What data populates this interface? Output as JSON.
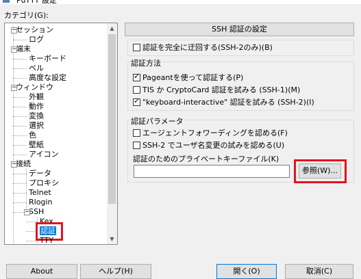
{
  "window": {
    "title": "PuTTY 設定"
  },
  "category_label": "カテゴリ(G):",
  "tree": [
    {
      "label": "セッション",
      "level": 0,
      "expander": "−"
    },
    {
      "label": "ログ",
      "level": 1
    },
    {
      "label": "端末",
      "level": 0,
      "expander": "−"
    },
    {
      "label": "キーボード",
      "level": 1
    },
    {
      "label": "ベル",
      "level": 1
    },
    {
      "label": "高度な設定",
      "level": 1
    },
    {
      "label": "ウィンドウ",
      "level": 0,
      "expander": "−"
    },
    {
      "label": "外観",
      "level": 1
    },
    {
      "label": "動作",
      "level": 1
    },
    {
      "label": "変換",
      "level": 1
    },
    {
      "label": "選択",
      "level": 1
    },
    {
      "label": "色",
      "level": 1
    },
    {
      "label": "壁紙",
      "level": 1
    },
    {
      "label": "アイコン",
      "level": 1
    },
    {
      "label": "接続",
      "level": 0,
      "expander": "−"
    },
    {
      "label": "データ",
      "level": 1
    },
    {
      "label": "プロキシ",
      "level": 1
    },
    {
      "label": "Telnet",
      "level": 1
    },
    {
      "label": "Rlogin",
      "level": 1
    },
    {
      "label": "SSH",
      "level": 1,
      "expander": "−"
    },
    {
      "label": "Kex",
      "level": 2
    },
    {
      "label": "認証",
      "level": 2,
      "selected": true
    },
    {
      "label": "TTY",
      "level": 2
    }
  ],
  "panel": {
    "header": "SSH 認証の設定",
    "bypass": {
      "label": "認証を完全に迂回する(SSH-2のみ)(B)",
      "checked": false
    },
    "methods_title": "認証方法",
    "methods": [
      {
        "label": "Pageantを使って認証する(P)",
        "checked": true
      },
      {
        "label": "TIS か CryptoCard 認証を試みる (SSH-1)(M)",
        "checked": false
      },
      {
        "label": "\"keyboard-interactive\" 認証を試みる (SSH-2)(I)",
        "checked": true
      }
    ],
    "params_title": "認証パラメータ",
    "params": [
      {
        "label": "エージェントフォワーディングを認める(F)",
        "checked": false
      },
      {
        "label": "SSH-2 でユーザ名変更の試みを認める(U)",
        "checked": false
      }
    ],
    "keyfile_label": "認証のためのプライベートキーファイル(K)",
    "keyfile_value": "",
    "browse_label": "参照(W)..."
  },
  "buttons": {
    "about": "About",
    "help": "ヘルプ(H)",
    "open": "開く(O)",
    "cancel": "取消(C)"
  },
  "colors": {
    "highlight": "#e0141e",
    "selection": "#0078d7"
  }
}
